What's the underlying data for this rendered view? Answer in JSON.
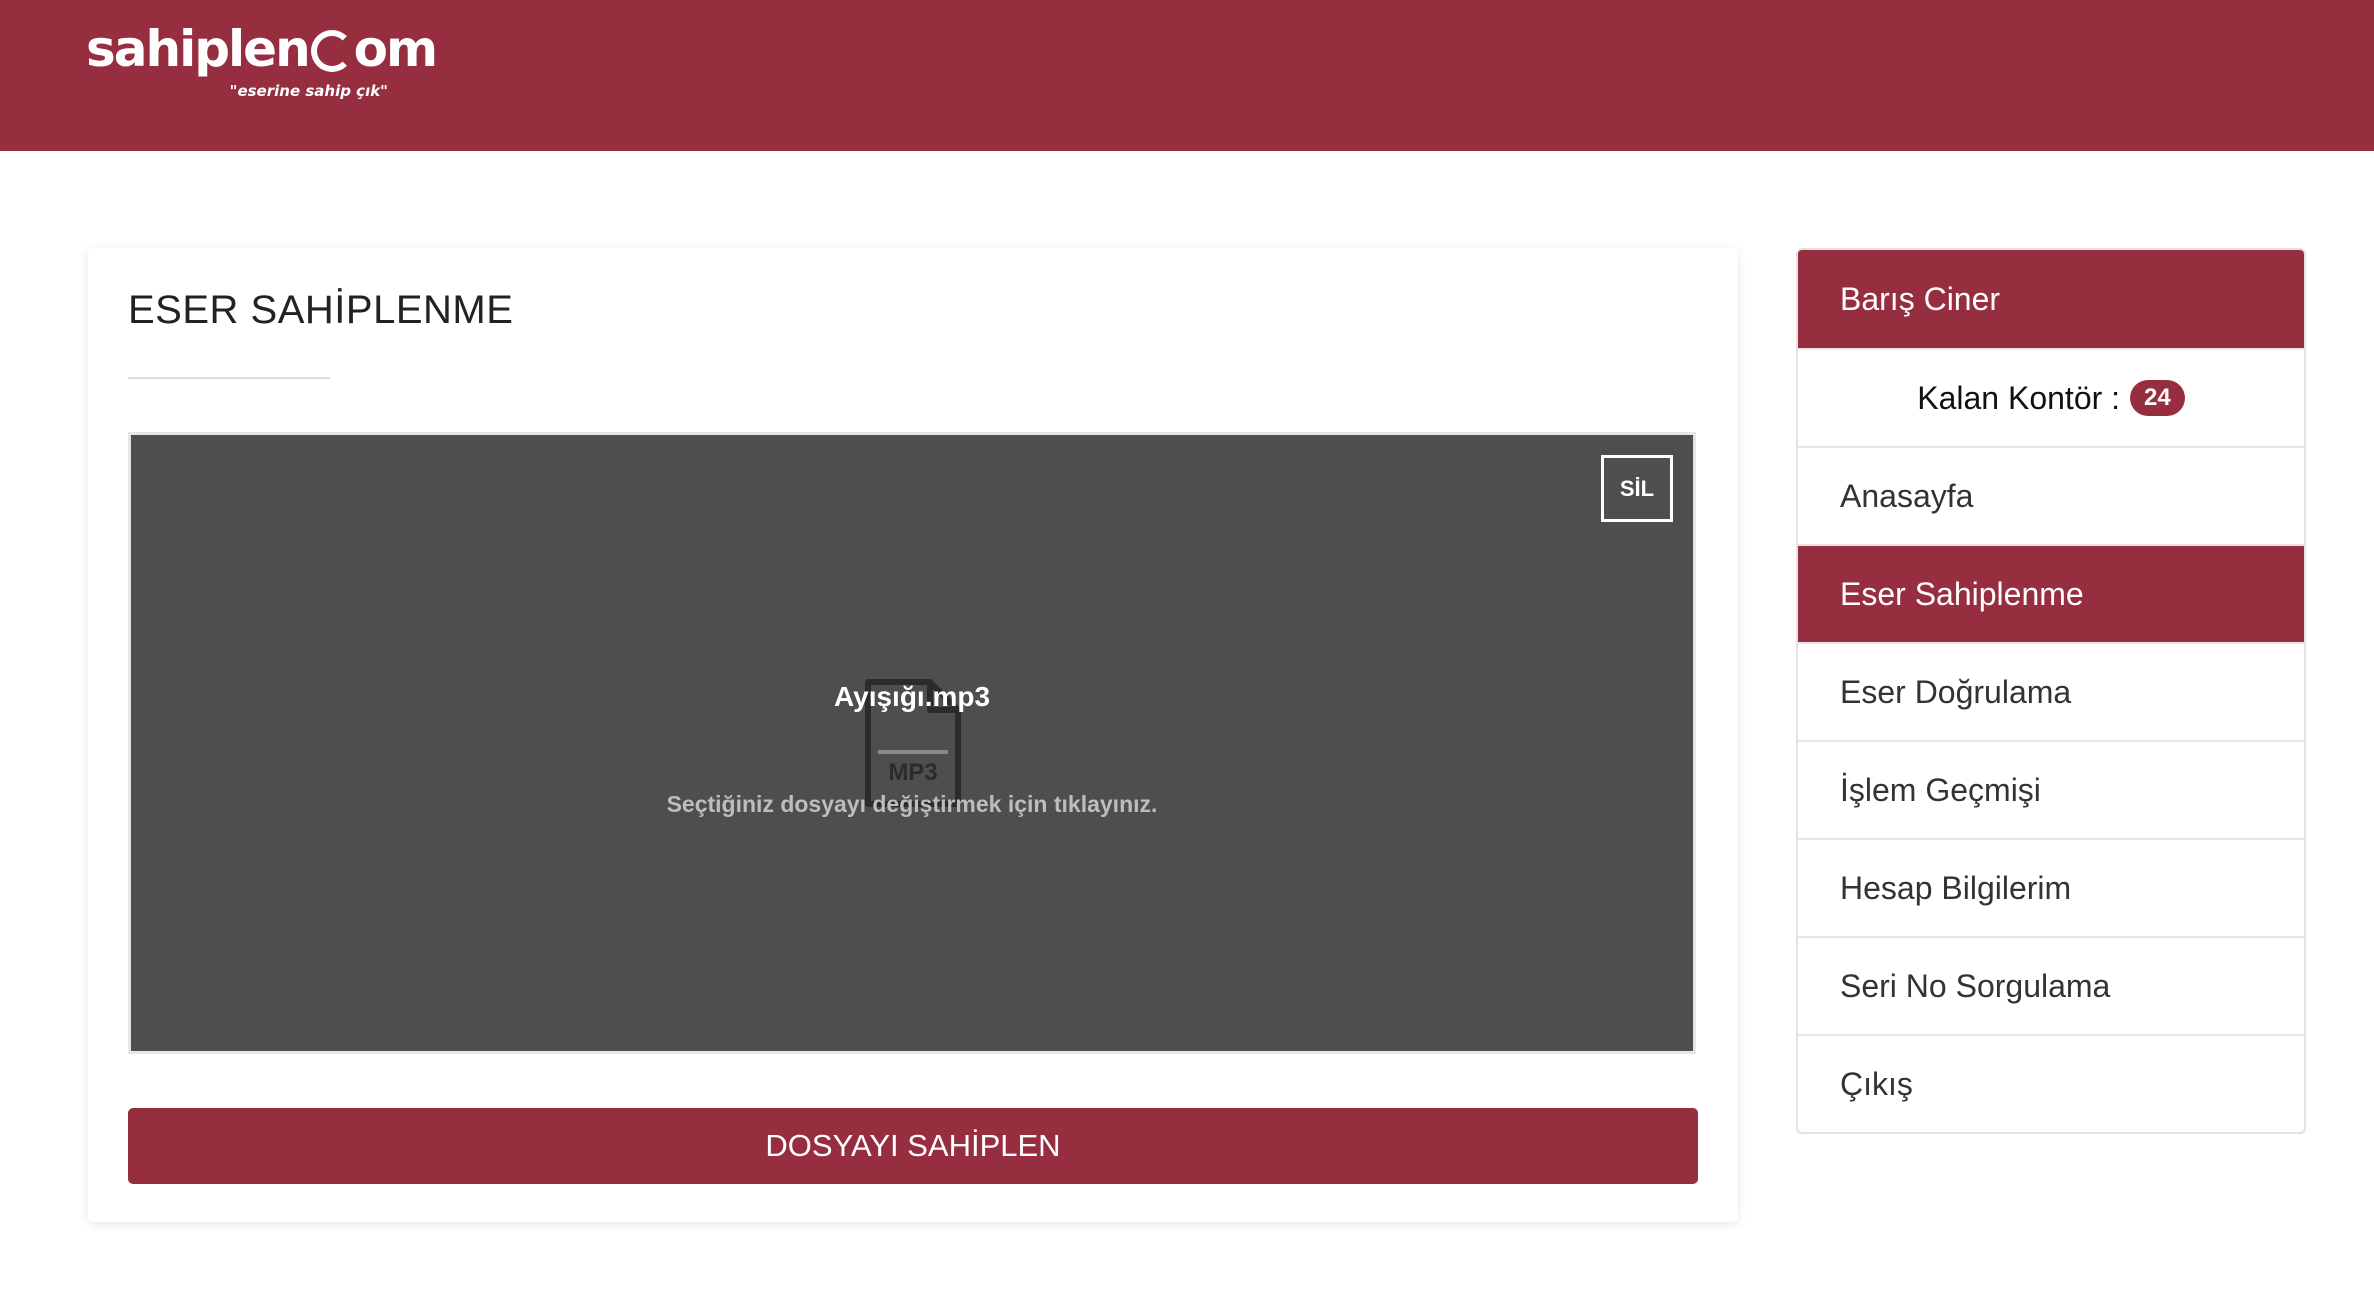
{
  "brand": {
    "logo_main_left": "sahiplen",
    "logo_main_right": "om",
    "tagline": "\"eserine sahip çık\""
  },
  "colors": {
    "primary": "#972e40",
    "dropzone_bg": "#4e4e4e"
  },
  "main": {
    "title": "ESER SAHİPLENME",
    "dropzone": {
      "delete_label": "SİL",
      "file_type": "MP3",
      "file_icon": "file-mp3-icon",
      "file_name": "Ayışığı.mp3",
      "hint": "Seçtiğiniz dosyayı değiştirmek için tıklayınız."
    },
    "submit_label": "DOSYAYI SAHİPLEN"
  },
  "sidebar": {
    "user_name": "Barış Ciner",
    "credit_label": "Kalan Kontör :",
    "credit_value": "24",
    "items": [
      {
        "label": "Anasayfa",
        "active": false
      },
      {
        "label": "Eser Sahiplenme",
        "active": true
      },
      {
        "label": "Eser Doğrulama",
        "active": false
      },
      {
        "label": "İşlem Geçmişi",
        "active": false
      },
      {
        "label": "Hesap Bilgilerim",
        "active": false
      },
      {
        "label": "Seri No Sorgulama",
        "active": false
      },
      {
        "label": "Çıkış",
        "active": false
      }
    ]
  }
}
